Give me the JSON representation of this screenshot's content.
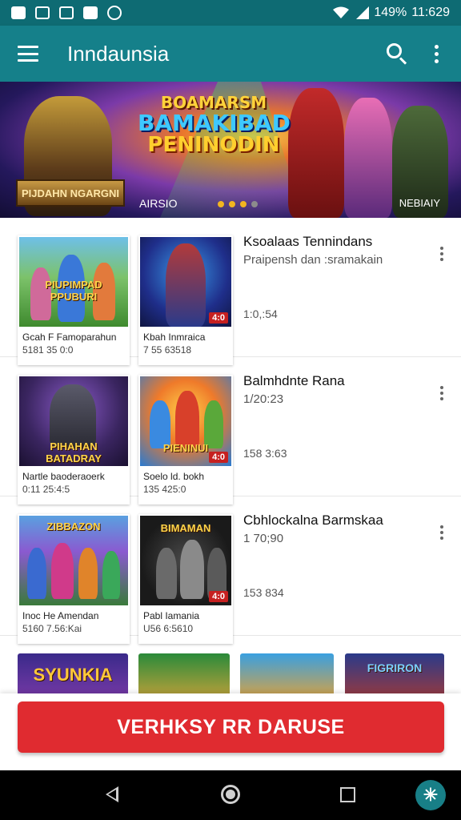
{
  "status_bar": {
    "battery": "149%",
    "time": "11:629",
    "icons": [
      "notification-icon",
      "image-icon",
      "app-icon",
      "bookmark-icon",
      "camera-icon",
      "wifi-icon",
      "signal-icon"
    ]
  },
  "app_bar": {
    "title": "Inndaunsia",
    "icons": [
      "menu-icon",
      "search-icon",
      "overflow-icon"
    ]
  },
  "banner": {
    "title_line1": "BOAMARSM",
    "title_line2": "BAMAKIBAD",
    "title_line3": "PENINODIN",
    "plaque_text": "PIJDAHN NGARGNI",
    "left_label": "AIRSIO",
    "right_label": "NEBIAIY",
    "dots": 4,
    "active_dots": 3
  },
  "rows": [
    {
      "cards": [
        {
          "thumb_label": "PIUPIMPAD PPUBURI",
          "caption1": "Gcah F Famoparahun",
          "caption2": "5181 35 0:0",
          "badge": ""
        },
        {
          "thumb_label": "",
          "caption1": "Kbah Inmraica",
          "caption2": "7 55 63518",
          "badge": "4:0"
        }
      ],
      "title": "Ksoalaas Tennindans",
      "subtitle": "Praipensh dan :sramakain",
      "stat": "1:0,:54"
    },
    {
      "cards": [
        {
          "thumb_label": "PIHAHAN BATADRAY",
          "caption1": "Nartle baoderaoerk",
          "caption2": "0:11 25:4:5",
          "badge": ""
        },
        {
          "thumb_label": "PIENINUI",
          "caption1": "Soelo ld. bokh",
          "caption2": "135 425:0",
          "badge": "4:0"
        }
      ],
      "title": "Balmhdnte Rana",
      "subtitle": "1/20:23",
      "stat": "158 3:63"
    },
    {
      "cards": [
        {
          "thumb_label": "ZIBBAZON",
          "caption1": "Inoc He Amendan",
          "caption2": "5160 7.56:Kai",
          "badge": ""
        },
        {
          "thumb_label": "BIMAMAN",
          "caption1": "Pabl Iamania",
          "caption2": "U56 6:5610",
          "badge": "4:0"
        }
      ],
      "title": "Cbhlockalna Barmskaa",
      "subtitle": "1 70;90",
      "stat": "153 834"
    }
  ],
  "strip": {
    "tiles": [
      "SYUNKIA",
      "",
      "",
      "FIGRIRON"
    ]
  },
  "cta": {
    "label": "VERHKSY RR DARUSE",
    "color": "#e02b30"
  },
  "nav_bar": {
    "icons": [
      "back-icon",
      "home-icon",
      "recents-icon",
      "assistant-icon"
    ]
  },
  "colors": {
    "app_bar": "#15808a",
    "status_bar": "#0e6b73",
    "accent_dot": "#f2b520"
  }
}
